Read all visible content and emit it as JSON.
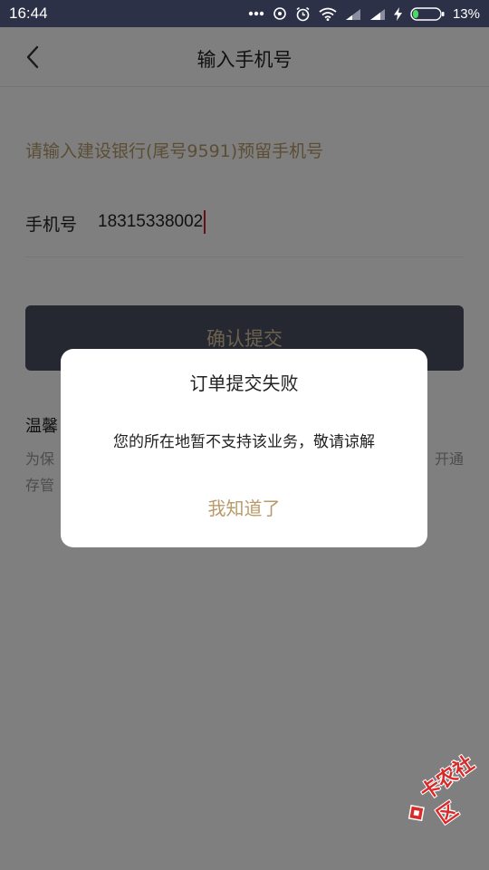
{
  "status_bar": {
    "time": "16:44",
    "battery_percent": "13%",
    "icons": [
      "more-dots-icon",
      "sync-icon",
      "alarm-icon",
      "wifi-icon",
      "signal-icon",
      "signal-icon",
      "charging-icon",
      "battery-icon"
    ]
  },
  "header": {
    "title": "输入手机号",
    "back_icon": "back-chevron-icon"
  },
  "form": {
    "hint": "请输入建设银行(尾号9591)预留手机号",
    "phone_label": "手机号",
    "phone_value": "18315338002",
    "submit_label": "确认提交"
  },
  "tips": {
    "title": "温馨",
    "line1_start": "为保",
    "line1_end": "开通",
    "line2_start": "存管"
  },
  "dialog": {
    "title": "订单提交失败",
    "message": "您的所在地暂不支持该业务，敬请谅解",
    "button_label": "我知道了"
  },
  "watermark": {
    "text": "卡农社区"
  },
  "colors": {
    "status_bar": "#2c3148",
    "accent_gold": "#b99a6a",
    "button_bg": "#4b5160",
    "watermark_red": "#d92a2a"
  }
}
